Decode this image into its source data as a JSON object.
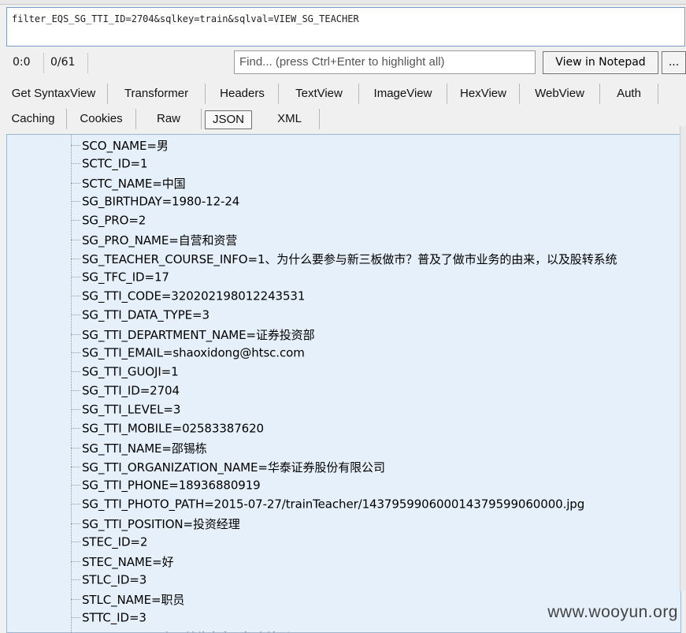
{
  "request": {
    "text": "filter_EQS_SG_TTI_ID=2704&sqlkey=train&sqlval=VIEW_SG_TEACHER"
  },
  "toolbar": {
    "position": "0:0",
    "count": "0/61",
    "find_placeholder": "Find... (press Ctrl+Enter to highlight all)",
    "notepad_label": "View in Notepad",
    "more_label": "..."
  },
  "tabs_row1": [
    "Get SyntaxView",
    "Transformer",
    "Headers",
    "TextView",
    "ImageView",
    "HexView",
    "WebView",
    "Auth"
  ],
  "tabs_row2": [
    "Caching",
    "Cookies",
    "Raw",
    "JSON",
    "XML"
  ],
  "selected_tab": "JSON",
  "tree": [
    "SCO_NAME=男",
    "SCTC_ID=1",
    "SCTC_NAME=中国",
    "SG_BIRTHDAY=1980-12-24",
    "SG_PRO=2",
    "SG_PRO_NAME=自营和资营",
    "SG_TEACHER_COURSE_INFO=1、为什么要参与新三板做市？普及了做市业务的由来，以及股转系统",
    "SG_TFC_ID=17",
    "SG_TTI_CODE=320202198012243531",
    "SG_TTI_DATA_TYPE=3",
    "SG_TTI_DEPARTMENT_NAME=证券投资部",
    "SG_TTI_EMAIL=shaoxidong@htsc.com",
    "SG_TTI_GUOJI=1",
    "SG_TTI_ID=2704",
    "SG_TTI_LEVEL=3",
    "SG_TTI_MOBILE=02583387620",
    "SG_TTI_NAME=邵锡栋",
    "SG_TTI_ORGANIZATION_NAME=华泰证券股份有限公司",
    "SG_TTI_PHONE=18936880919",
    "SG_TTI_PHOTO_PATH=2015-07-27/trainTeacher/14379599060001437959906000​0.jpg",
    "SG_TTI_POSITION=投资经理",
    "STEC_ID=2",
    "STEC_NAME=好",
    "STLC_ID=3",
    "STLC_NAME=职员",
    "STTC_ID=3",
    "STTC_NAME=会员单位自由职投资培训"
  ],
  "watermark": "www.wooyun.org"
}
